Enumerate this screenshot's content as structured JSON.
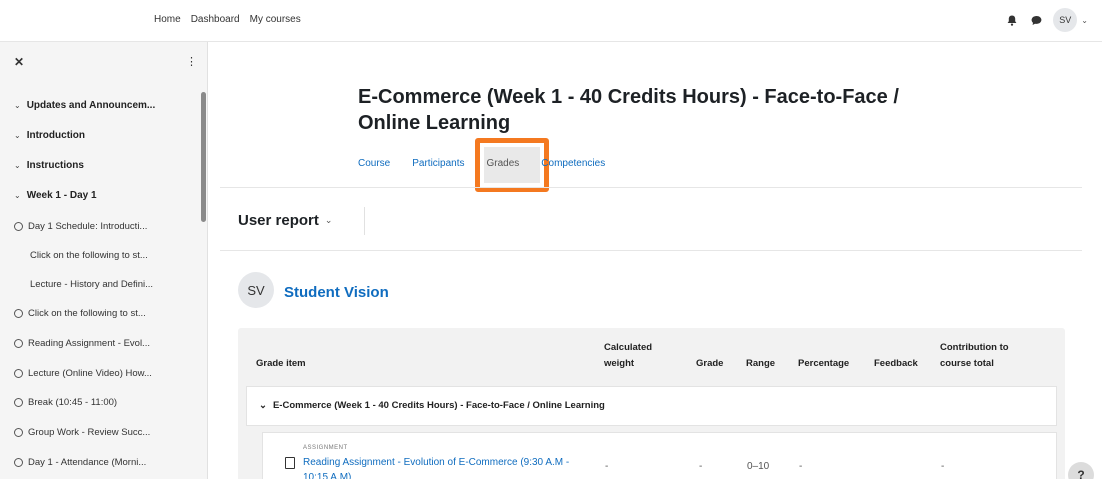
{
  "topbar": {
    "nav": [
      "Home",
      "Dashboard",
      "My courses"
    ],
    "user_initials": "SV"
  },
  "drawer": {
    "sections": [
      {
        "label": "Updates and Announcem..."
      },
      {
        "label": "Introduction"
      },
      {
        "label": "Instructions"
      },
      {
        "label": "Week 1 - Day 1"
      }
    ],
    "activities": [
      {
        "label": "Day 1 Schedule: Introducti...",
        "circle": true
      },
      {
        "label": "Click on the following to st...",
        "circle": false
      },
      {
        "label": "Lecture - History and Defini...",
        "circle": false
      },
      {
        "label": "Click on the following to st...",
        "circle": true
      },
      {
        "label": "Reading Assignment - Evol...",
        "circle": true
      },
      {
        "label": "Lecture (Online Video) How...",
        "circle": true
      },
      {
        "label": "Break (10:45 - 11:00)",
        "circle": true
      },
      {
        "label": "Group Work - Review Succ...",
        "circle": true
      },
      {
        "label": "Day 1 - Attendance (Morni...",
        "circle": true
      }
    ]
  },
  "course": {
    "title": "E-Commerce (Week 1 - 40 Credits Hours) - Face-to-Face / Online Learning",
    "tabs": [
      "Course",
      "Participants",
      "Grades",
      "Competencies"
    ],
    "active_tab": "Grades"
  },
  "report": {
    "selector": "User report",
    "user_initials": "SV",
    "user_name": "Student Vision"
  },
  "table": {
    "headers": {
      "grade_item": "Grade item",
      "calculated_weight": "Calculated weight",
      "grade": "Grade",
      "range": "Range",
      "percentage": "Percentage",
      "feedback": "Feedback",
      "contribution": "Contribution to course total"
    },
    "category": "E-Commerce (Week 1 - 40 Credits Hours) - Face-to-Face / Online Learning",
    "item": {
      "type": "ASSIGNMENT",
      "name": "Reading Assignment - Evolution of E-Commerce (9:30 A.M - 10:15 A.M)",
      "weight": "-",
      "grade": "-",
      "range": "0–10",
      "percentage": "-",
      "contribution": "-"
    }
  },
  "help_label": "?",
  "colors": {
    "accent": "#0f6cbf",
    "highlight": "#f47920"
  }
}
